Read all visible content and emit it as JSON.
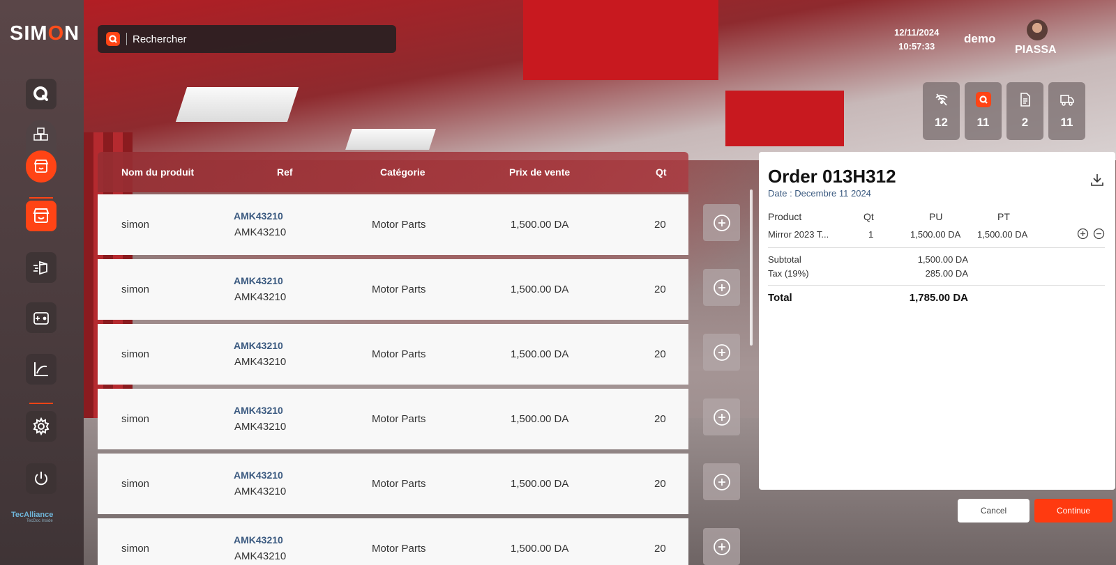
{
  "app": {
    "logo_left": "SIM",
    "logo_o": "O",
    "logo_right": "N",
    "partner": "TecAlliance",
    "partner_tag": "TecDoc Inside"
  },
  "search": {
    "placeholder": "Rechercher"
  },
  "header": {
    "date": "12/11/2024",
    "time": "10:57:33",
    "user": "demo",
    "store": "PIASSA"
  },
  "stats": [
    {
      "icon": "wifi-off-icon",
      "value": "12"
    },
    {
      "icon": "search-badge-icon",
      "value": "11"
    },
    {
      "icon": "document-icon",
      "value": "2"
    },
    {
      "icon": "truck-icon",
      "value": "11"
    }
  ],
  "table": {
    "headers": {
      "name": "Nom du produit",
      "ref": "Ref",
      "category": "Catégorie",
      "price": "Prix de vente",
      "qty": "Qt"
    },
    "rows": [
      {
        "name": "simon",
        "ref_primary": "AMK43210",
        "ref_secondary": "AMK43210",
        "category": "Motor Parts",
        "price": "1,500.00 DA",
        "qty": "20"
      },
      {
        "name": "simon",
        "ref_primary": "AMK43210",
        "ref_secondary": "AMK43210",
        "category": "Motor Parts",
        "price": "1,500.00 DA",
        "qty": "20"
      },
      {
        "name": "simon",
        "ref_primary": "AMK43210",
        "ref_secondary": "AMK43210",
        "category": "Motor Parts",
        "price": "1,500.00 DA",
        "qty": "20"
      },
      {
        "name": "simon",
        "ref_primary": "AMK43210",
        "ref_secondary": "AMK43210",
        "category": "Motor Parts",
        "price": "1,500.00 DA",
        "qty": "20"
      },
      {
        "name": "simon",
        "ref_primary": "AMK43210",
        "ref_secondary": "AMK43210",
        "category": "Motor Parts",
        "price": "1,500.00 DA",
        "qty": "20"
      },
      {
        "name": "simon",
        "ref_primary": "AMK43210",
        "ref_secondary": "AMK43210",
        "category": "Motor Parts",
        "price": "1,500.00 DA",
        "qty": "20"
      }
    ]
  },
  "order": {
    "title": "Order 013H312",
    "date": "Date : Decembre 11 2024",
    "headers": {
      "product": "Product",
      "qty": "Qt",
      "pu": "PU",
      "pt": "PT"
    },
    "item": {
      "product": "Mirror 2023 T...",
      "qty": "1",
      "pu": "1,500.00 DA",
      "pt": "1,500.00 DA"
    },
    "subtotal_label": "Subtotal",
    "subtotal": "1,500.00 DA",
    "tax_label": "Tax (19%)",
    "tax": "285.00 DA",
    "total_label": "Total",
    "total": "1,785.00 DA"
  },
  "actions": {
    "cancel": "Cancel",
    "continue": "Continue"
  },
  "colors": {
    "accent": "#ff4415",
    "ref_text": "#3b5a80"
  }
}
